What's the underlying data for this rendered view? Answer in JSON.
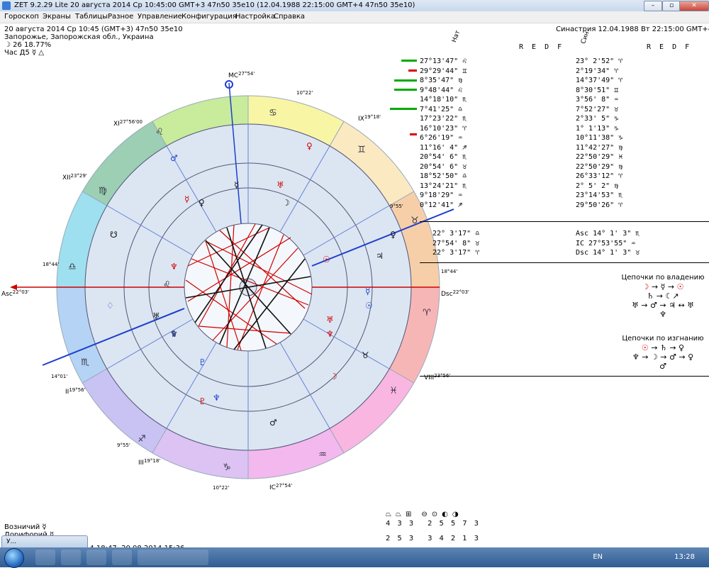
{
  "window": {
    "title": "ZET 9.2.29 Lite   20 августа 2014  Ср  10:45:00 GMT+3 47n50  35e10   (12.04.1988  22:15:00 GMT+4 47n50 35e10)"
  },
  "menu": [
    "Гороскоп",
    "Экраны",
    "Таблицы",
    "Разное",
    "Управление",
    "Конфигурация",
    "Настройка",
    "Справка"
  ],
  "header": {
    "line1": "20 августа 2014  Ср  10:45 (GMT+3) 47n50  35e10",
    "line2": "Запорожье, Запорожская обл., Украина",
    "line3": "☽  26 18.77%",
    "line4": "Час Д5  ☿ △",
    "synastry": "Синастрия 12.04.1988  Вт 22:15:00 GMT+4"
  },
  "table": {
    "head_nat": "Нат",
    "head_syn": "Син",
    "cols": "R  E  D  F",
    "rows_nat": [
      "27°13'47\" ♌",
      "29°29'44\" ♊",
      "8°35'47\" ♍",
      "9°48'44\" ♌",
      "14°18'10\" ♏",
      "7°41'25\" ♎",
      "17°23'22\" ♏",
      "16°10'23\" ♈",
      "6°26'19\" ♒",
      "11°16' 4\" ♐",
      "20°54' 6\" ♏",
      "20°54' 6\" ♉",
      "18°52'50\" ♎",
      "13°24'21\" ♏",
      "9°18'29\" ♒",
      "0°12'41\" ♐"
    ],
    "rows_syn": [
      "23° 2'52\" ♈",
      "2°19'34\" ♈",
      "14°37'49\" ♈",
      "8°30'51\" ♊",
      "3°56' 8\" ♒",
      "7°52'27\" ♉",
      "2°33' 5\" ♑",
      "1° 1'13\" ♑",
      "10°11'38\" ♑",
      "11°42'27\" ♍",
      "22°50'29\" ♓",
      "22°50'29\" ♍",
      "26°33'12\" ♈",
      "2° 5' 2\" ♍",
      "23°14'53\" ♏",
      "29°50'26\" ♈"
    ],
    "angles_nat": [
      "22° 3'17\" ♎",
      "27°54' 8\" ♉",
      "22° 3'17\" ♈"
    ],
    "angles_syn": [
      "Asc 14° 1' 3\" ♏",
      "IC 27°53'55\" ♒",
      "Dsc 14° 1' 3\" ♉"
    ]
  },
  "chains": {
    "owner_title": "Цепочки по владению",
    "exile_title": "Цепочки по изгнанию"
  },
  "chart_labels": {
    "mc": "MC",
    "mc_deg": "27°54'",
    "ic": "IC",
    "ic_deg": "27°54'",
    "asc": "Asc",
    "asc_deg": "22°03'",
    "dsc": "Dsc",
    "dsc_deg": "22°03'",
    "c11": "XI",
    "c11_deg": "27°56'00",
    "c12": "XII",
    "c12_deg": "23°29'",
    "c9": "IX",
    "c9_deg": "19°18'",
    "c8": "VIII",
    "c8_deg": "23°56'",
    "c3": "III",
    "c3_deg": "19°18'",
    "c2": "II",
    "c2_deg": "19°56'",
    "deg_10_22": "10°22'",
    "deg_9_55": "9°55'",
    "deg_18_44": "18°44'",
    "deg_14_01": "14°01'"
  },
  "footer": {
    "vozn": "Возничий  ☿",
    "dor": "Дорифорий  ☿",
    "row_top": [
      "4",
      "3",
      "3",
      "2",
      "5",
      "5",
      "7",
      "3"
    ],
    "row_bot": [
      "2",
      "5",
      "3",
      "3",
      "4",
      "2",
      "1",
      "3"
    ],
    "status": "14 18:47,  20.08.2014 15:36",
    "lang": "EN",
    "clock": "13:28"
  },
  "colors": {
    "red": "#d00000",
    "blue": "#1e3ecf",
    "ring": "#dbe6f2"
  }
}
